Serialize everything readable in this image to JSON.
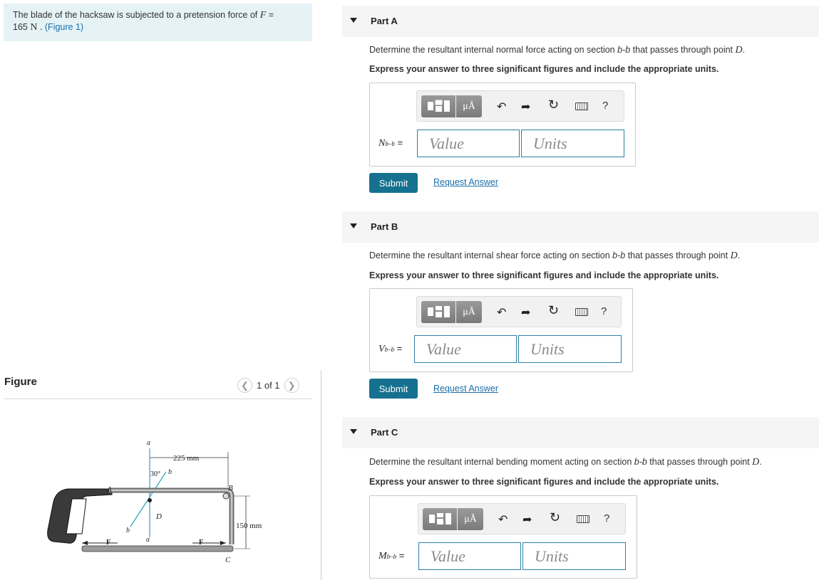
{
  "problem": {
    "text_before": "The blade of the hacksaw is subjected to a pretension force of ",
    "force_var": "F",
    "equals": " =",
    "value": "165",
    "unit": "N",
    "figure_link": "(Figure 1)"
  },
  "figure": {
    "heading": "Figure",
    "pager_text": "1 of 1",
    "prev_icon": "chevron-left",
    "next_icon": "chevron-right",
    "labels": {
      "a_top": "a",
      "dim_225": "225 mm",
      "angle_30": "30°",
      "b_top": "b",
      "A": "A",
      "B": "B",
      "D": "D",
      "b_bottom": "b",
      "a_bottom": "a",
      "dim_150": "150 mm",
      "F_left": "F",
      "F_right": "F",
      "C": "C"
    }
  },
  "toolbar": {
    "units_button": "μÅ",
    "icons": [
      "matrix-template-icon",
      "units-icon",
      "undo-icon",
      "redo-icon",
      "reset-icon",
      "keyboard-icon",
      "help-icon"
    ],
    "undo": "↶",
    "redo": "➦",
    "reset": "↻",
    "help": "?"
  },
  "parts": [
    {
      "label": "Part A",
      "question_before": "Determine the resultant internal normal force acting on section ",
      "section": "b-b",
      "question_after": " that passes through point ",
      "point": "D",
      "period": ".",
      "instruction": "Express your answer to three significant figures and include the appropriate units.",
      "var": "N",
      "sub": "b–b",
      "eq": " =",
      "value_placeholder": "Value",
      "units_placeholder": "Units",
      "submit": "Submit",
      "request": "Request Answer"
    },
    {
      "label": "Part B",
      "question_before": "Determine the resultant internal shear force acting on section ",
      "section": "b-b",
      "question_after": " that passes through point ",
      "point": "D",
      "period": ".",
      "instruction": "Express your answer to three significant figures and include the appropriate units.",
      "var": "V",
      "sub": "b–b",
      "eq": " =",
      "value_placeholder": "Value",
      "units_placeholder": "Units",
      "submit": "Submit",
      "request": "Request Answer"
    },
    {
      "label": "Part C",
      "question_before": "Determine the resultant internal bending moment acting on section ",
      "section": "b-b",
      "question_after": " that passes through point ",
      "point": "D",
      "period": ".",
      "instruction": "Express your answer to three significant figures and include the appropriate units.",
      "var": "M",
      "sub": "b–b",
      "eq": " =",
      "value_placeholder": "Value",
      "units_placeholder": "Units"
    }
  ]
}
